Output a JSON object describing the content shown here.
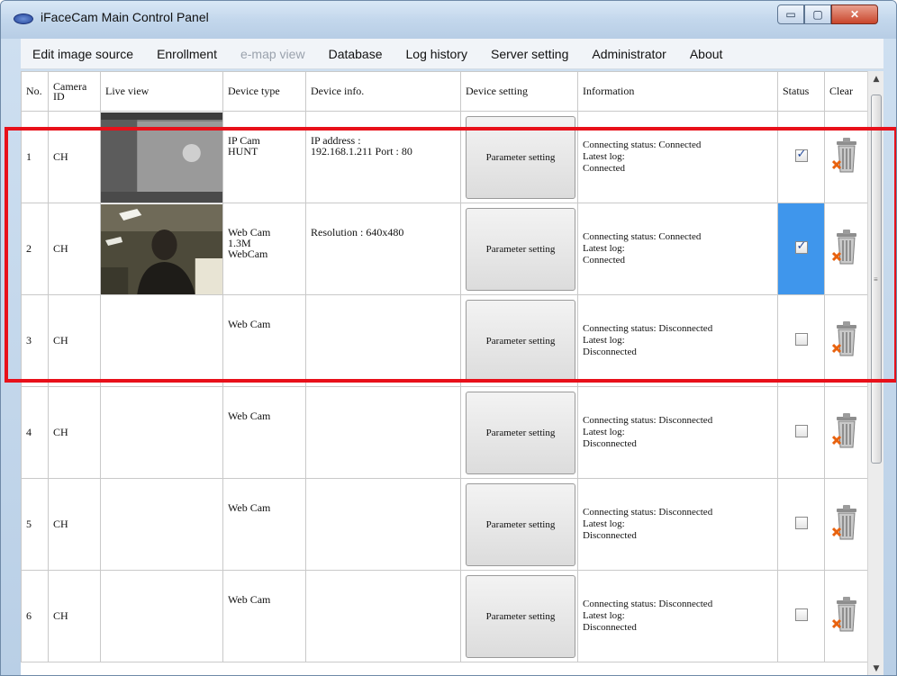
{
  "window": {
    "title": "iFaceCam Main Control Panel",
    "minimize_glyph": "▭",
    "maximize_glyph": "▢",
    "close_glyph": "✕"
  },
  "menu": [
    {
      "label": "Edit image source",
      "enabled": true
    },
    {
      "label": "Enrollment",
      "enabled": true
    },
    {
      "label": "e-map view",
      "enabled": false
    },
    {
      "label": "Database",
      "enabled": true
    },
    {
      "label": "Log history",
      "enabled": true
    },
    {
      "label": "Server setting",
      "enabled": true
    },
    {
      "label": "Administrator",
      "enabled": true
    },
    {
      "label": "About",
      "enabled": true
    }
  ],
  "table": {
    "headers": {
      "no": "No.",
      "camera_id": "Camera ID",
      "live_view": "Live view",
      "device_type": "Device type",
      "device_info": "Device info.",
      "device_setting": "Device setting",
      "information": "Information",
      "status": "Status",
      "clear": "Clear"
    },
    "rows": [
      {
        "no": "1",
        "camera_id": "CH",
        "live": "ip-cam-feed",
        "device_type": "IP Cam\nHUNT",
        "device_info": "IP address :\n192.168.1.211  Port : 80",
        "button": "Parameter setting",
        "info": "Connecting status: Connected\nLatest log:\nConnected",
        "status_checked": true,
        "status_highlight": false
      },
      {
        "no": "2",
        "camera_id": "CH",
        "live": "webcam-feed",
        "device_type": "Web Cam\n1.3M\nWebCam",
        "device_info": "Resolution : 640x480",
        "button": "Parameter setting",
        "info": "Connecting status: Connected\nLatest log:\nConnected",
        "status_checked": true,
        "status_highlight": true
      },
      {
        "no": "3",
        "camera_id": "CH",
        "live": "",
        "device_type": "Web Cam",
        "device_info": "",
        "button": "Parameter setting",
        "info": "Connecting status: Disconnected\nLatest log:\nDisconnected",
        "status_checked": false,
        "status_highlight": false
      },
      {
        "no": "4",
        "camera_id": "CH",
        "live": "",
        "device_type": "Web Cam",
        "device_info": "",
        "button": "Parameter setting",
        "info": "Connecting status: Disconnected\nLatest log:\nDisconnected",
        "status_checked": false,
        "status_highlight": false
      },
      {
        "no": "5",
        "camera_id": "CH",
        "live": "",
        "device_type": "Web Cam",
        "device_info": "",
        "button": "Parameter setting",
        "info": "Connecting status: Disconnected\nLatest log:\nDisconnected",
        "status_checked": false,
        "status_highlight": false
      },
      {
        "no": "6",
        "camera_id": "CH",
        "live": "",
        "device_type": "Web Cam",
        "device_info": "",
        "button": "Parameter setting",
        "info": "Connecting status: Disconnected\nLatest log:\nDisconnected",
        "status_checked": false,
        "status_highlight": false
      }
    ]
  },
  "icons": {
    "app": "eye-icon",
    "clear": "trash-icon",
    "scroll_up": "▲",
    "scroll_down": "▼",
    "scroll_grip": "≡"
  },
  "colors": {
    "highlight_box": "#e8101a",
    "status_highlight": "#3f96ec"
  }
}
